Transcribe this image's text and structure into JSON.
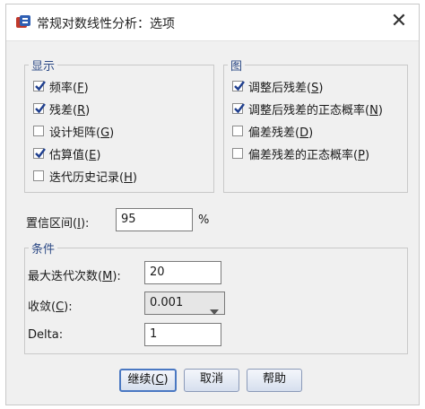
{
  "window": {
    "title": "常规对数线性分析：选项",
    "close_glyph": "✕"
  },
  "display": {
    "legend": "显示",
    "items": [
      {
        "label": "频率",
        "mnemonic": "F",
        "checked": true
      },
      {
        "label": "残差",
        "mnemonic": "R",
        "checked": true
      },
      {
        "label": "设计矩阵",
        "mnemonic": "G",
        "checked": false
      },
      {
        "label": "估算值",
        "mnemonic": "E",
        "checked": true
      },
      {
        "label": "迭代历史记录",
        "mnemonic": "H",
        "checked": false
      }
    ]
  },
  "plot": {
    "legend": "图",
    "items": [
      {
        "label": "调整后残差",
        "mnemonic": "S",
        "checked": true
      },
      {
        "label": "调整后残差的正态概率",
        "mnemonic": "N",
        "checked": true
      },
      {
        "label": "偏差残差",
        "mnemonic": "D",
        "checked": false
      },
      {
        "label": "偏差残差的正态概率",
        "mnemonic": "P",
        "checked": false
      }
    ]
  },
  "confidence": {
    "label": "置信区间",
    "mnemonic": "I",
    "value": "95",
    "unit": "%"
  },
  "criteria": {
    "legend": "条件",
    "max_iter_label": "最大迭代次数",
    "max_iter_mnemonic": "M",
    "max_iter_value": "20",
    "convergence_label": "收敛",
    "convergence_mnemonic": "C",
    "convergence_value": "0.001",
    "delta_label": "Delta",
    "delta_value": "1"
  },
  "buttons": {
    "continue_label": "继续",
    "continue_mnemonic": "C",
    "cancel_label": "取消",
    "help_label": "帮助"
  },
  "colors": {
    "legend_text": "#2d4a86",
    "default_button_border": "#4a78c2",
    "check_mark": "#1f3f8f"
  }
}
